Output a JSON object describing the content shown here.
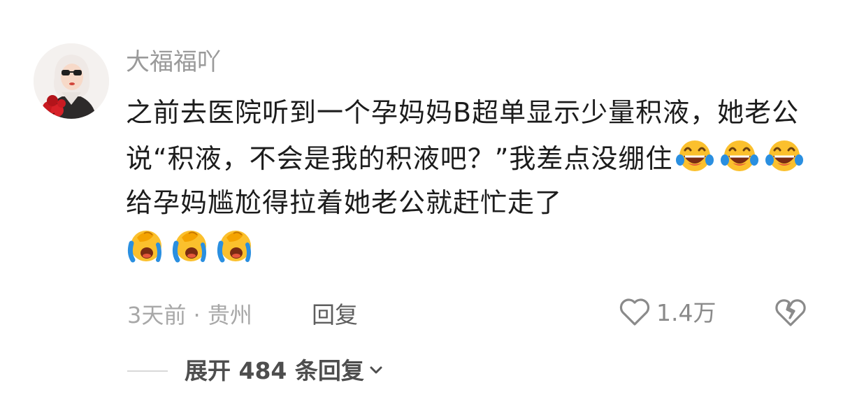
{
  "comment": {
    "username": "大福福吖",
    "avatar_icon": "avatar-girl-with-roses",
    "text_parts": [
      "之前去医院听到一个孕妈妈B超单显示少量积液，她老公说“积液，不会是我的积液吧？”我差点没绷住",
      "给孕妈尴尬得拉着她老公就赶忙走了"
    ],
    "emoji_laugh_cry_icon": "laugh-cry-emoji",
    "emoji_sob_icon": "loudly-crying-emoji",
    "time_location": "3天前 · 贵州",
    "reply_label": "回复",
    "like_count": "1.4万",
    "like_icon": "heart-outline-icon",
    "dislike_icon": "broken-heart-icon"
  },
  "replies": {
    "expand_label": "展开 484 条回复",
    "expand_icon": "chevron-down-icon"
  },
  "colors": {
    "username": "#9a9a9a",
    "text": "#1c1c1c",
    "meta": "#a8a8a8",
    "emoji_yellow": "#fbc02d",
    "emoji_tear": "#2a8fe0"
  }
}
